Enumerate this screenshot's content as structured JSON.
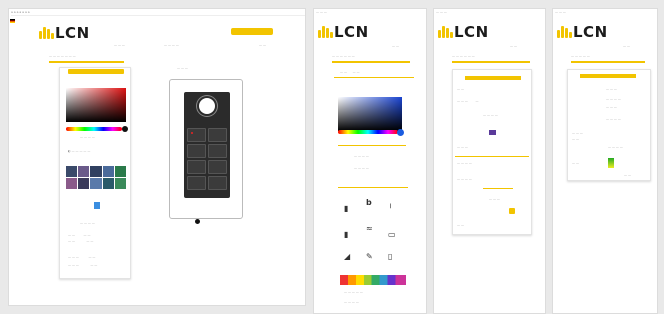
{
  "brand": {
    "name": "LCN",
    "accent": "#f2c400",
    "dark": "#1c1c1c"
  },
  "main": {
    "browser_bar_text": "a a a a a a a",
    "top_button_label": "",
    "panel_tab_label": "",
    "icons": {
      "lamp": "lightbulb-icon",
      "record": "record-dot-icon"
    }
  },
  "screen2": {
    "title": ""
  },
  "screen3": {
    "title": ""
  },
  "screen4": {
    "title": ""
  }
}
